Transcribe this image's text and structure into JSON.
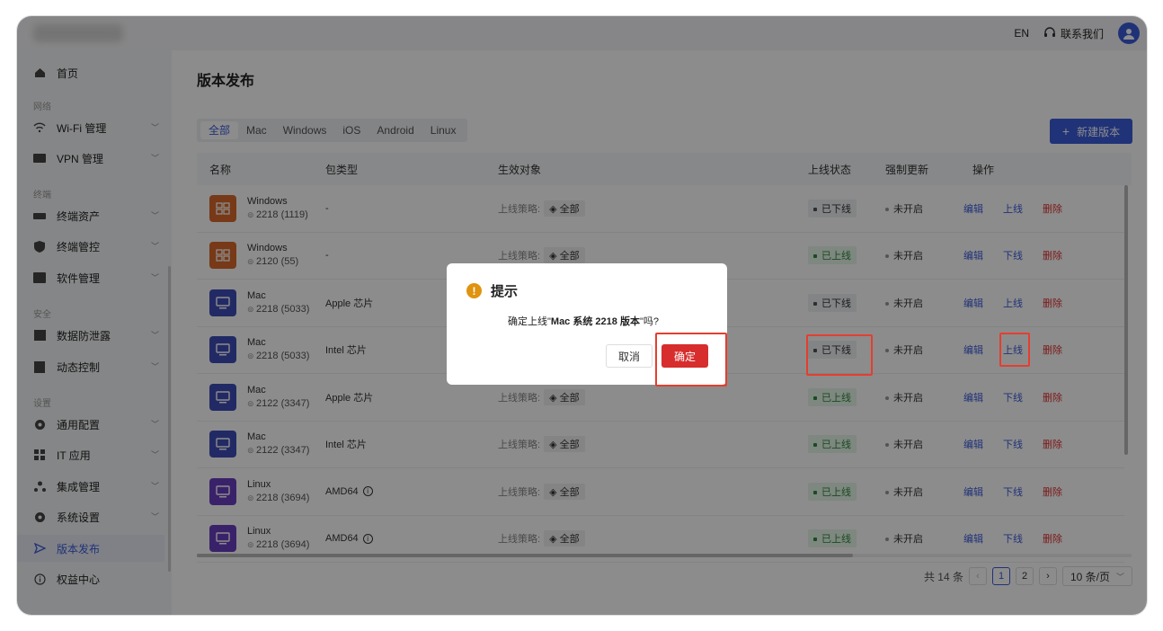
{
  "topbar": {
    "lang": "EN",
    "contact": "联系我们"
  },
  "sidebar": {
    "home": "首页",
    "group_network": "网络",
    "wifi": "Wi-Fi 管理",
    "vpn": "VPN 管理",
    "group_terminal": "终端",
    "assets": "终端资产",
    "control": "终端管控",
    "software": "软件管理",
    "group_security": "安全",
    "dlp": "数据防泄露",
    "dynamic": "动态控制",
    "group_settings": "设置",
    "general": "通用配置",
    "itapps": "IT 应用",
    "integration": "集成管理",
    "system": "系统设置",
    "release": "版本发布",
    "license": "权益中心"
  },
  "main": {
    "title": "版本发布",
    "tabs": [
      "全部",
      "Mac",
      "Windows",
      "iOS",
      "Android",
      "Linux"
    ],
    "new_button": "新建版本",
    "columns": [
      "名称",
      "包类型",
      "生效对象",
      "上线状态",
      "强制更新",
      "操作"
    ],
    "strategy_label": "上线策略:",
    "strategy_value": "全部",
    "rows": [
      {
        "os": "Windows",
        "ver": "2218 (1119)",
        "pkg": "-",
        "status": "已下线",
        "online": false,
        "force": "未开启",
        "toggle": "上线",
        "color": "#d9682a"
      },
      {
        "os": "Windows",
        "ver": "2120 (55)",
        "pkg": "-",
        "status": "已上线",
        "online": true,
        "force": "未开启",
        "toggle": "下线",
        "color": "#d9682a"
      },
      {
        "os": "Mac",
        "ver": "2218 (5033)",
        "pkg": "Apple 芯片",
        "status": "已下线",
        "online": false,
        "force": "未开启",
        "toggle": "上线",
        "color": "#3f4db8"
      },
      {
        "os": "Mac",
        "ver": "2218 (5033)",
        "pkg": "Intel 芯片",
        "status": "已下线",
        "online": false,
        "force": "未开启",
        "toggle": "上线",
        "color": "#3f4db8"
      },
      {
        "os": "Mac",
        "ver": "2122 (3347)",
        "pkg": "Apple 芯片",
        "status": "已上线",
        "online": true,
        "force": "未开启",
        "toggle": "下线",
        "color": "#3f4db8"
      },
      {
        "os": "Mac",
        "ver": "2122 (3347)",
        "pkg": "Intel 芯片",
        "status": "已上线",
        "online": true,
        "force": "未开启",
        "toggle": "下线",
        "color": "#3f4db8"
      },
      {
        "os": "Linux",
        "ver": "2218 (3694)",
        "pkg": "AMD64",
        "status": "已上线",
        "online": true,
        "force": "未开启",
        "toggle": "下线",
        "color": "#6b3fc2"
      },
      {
        "os": "Linux",
        "ver": "2218 (3694)",
        "pkg": "AMD64",
        "status": "已上线",
        "online": true,
        "force": "未开启",
        "toggle": "下线",
        "color": "#6b3fc2"
      }
    ],
    "edit": "编辑",
    "delete": "删除",
    "pager": {
      "total": "共 14 条",
      "page1": "1",
      "page2": "2",
      "size": "10 条/页"
    }
  },
  "dialog": {
    "title": "提示",
    "msg_prefix": "确定上线\"",
    "msg_bold": "Mac 系统 2218 版本",
    "msg_suffix": "\"吗?",
    "cancel": "取消",
    "ok": "确定"
  }
}
